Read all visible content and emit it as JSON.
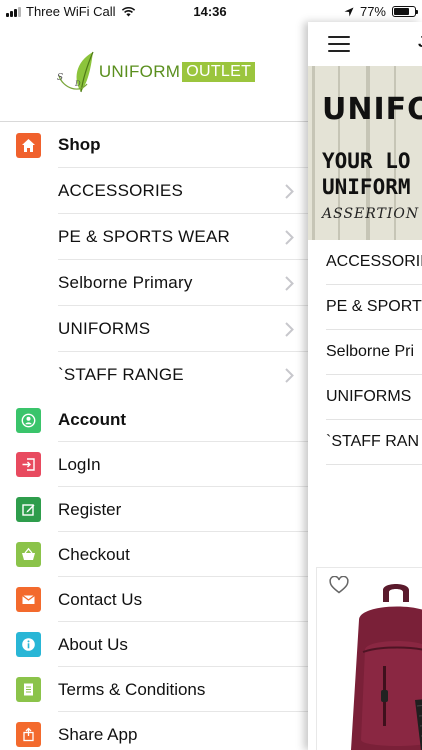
{
  "status_bar": {
    "carrier": "Three WiFi Call",
    "time": "14:36",
    "battery": "77%",
    "battery_level": 0.77
  },
  "logo": {
    "wordmark": "UNIFORM",
    "wordmark_highlight": "OUTLET",
    "mark_text": "S ... D"
  },
  "colors": {
    "shop": "#f0612d",
    "account": "#3ac46b",
    "login": "#e84a5f",
    "register": "#2e9d4c",
    "checkout": "#8bc34a",
    "contact": "#f36a2d",
    "about": "#29b6d6",
    "terms": "#8bc34a",
    "share": "#f36a2d",
    "logo_green": "#9bc53d"
  },
  "drawer": {
    "shop": {
      "label": "Shop",
      "icon": "home-icon"
    },
    "categories": [
      {
        "label": "ACCESSORIES"
      },
      {
        "label": "PE & SPORTS WEAR"
      },
      {
        "label": "Selborne Primary"
      },
      {
        "label": "UNIFORMS"
      },
      {
        "label": "`STAFF RANGE"
      }
    ],
    "account": {
      "label": "Account",
      "icon": "user-icon"
    },
    "items": [
      {
        "label": "LogIn",
        "icon": "login-icon"
      },
      {
        "label": "Register",
        "icon": "edit-icon"
      },
      {
        "label": "Checkout",
        "icon": "basket-icon"
      },
      {
        "label": "Contact Us",
        "icon": "mail-icon"
      },
      {
        "label": "About Us",
        "icon": "info-icon"
      },
      {
        "label": "Terms & Conditions",
        "icon": "document-icon"
      },
      {
        "label": "Share App",
        "icon": "share-icon"
      }
    ]
  },
  "main": {
    "top_letter": "J",
    "banner": {
      "line1": "UNIFO",
      "line2a": "YOUR LO",
      "line2b": "UNIFORM",
      "line3": "ASSERTION"
    },
    "categories": [
      {
        "label": "ACCESSORIE"
      },
      {
        "label": "PE & SPORT"
      },
      {
        "label": "Selborne Pri"
      },
      {
        "label": "UNIFORMS"
      },
      {
        "label": "`STAFF RAN"
      }
    ]
  }
}
